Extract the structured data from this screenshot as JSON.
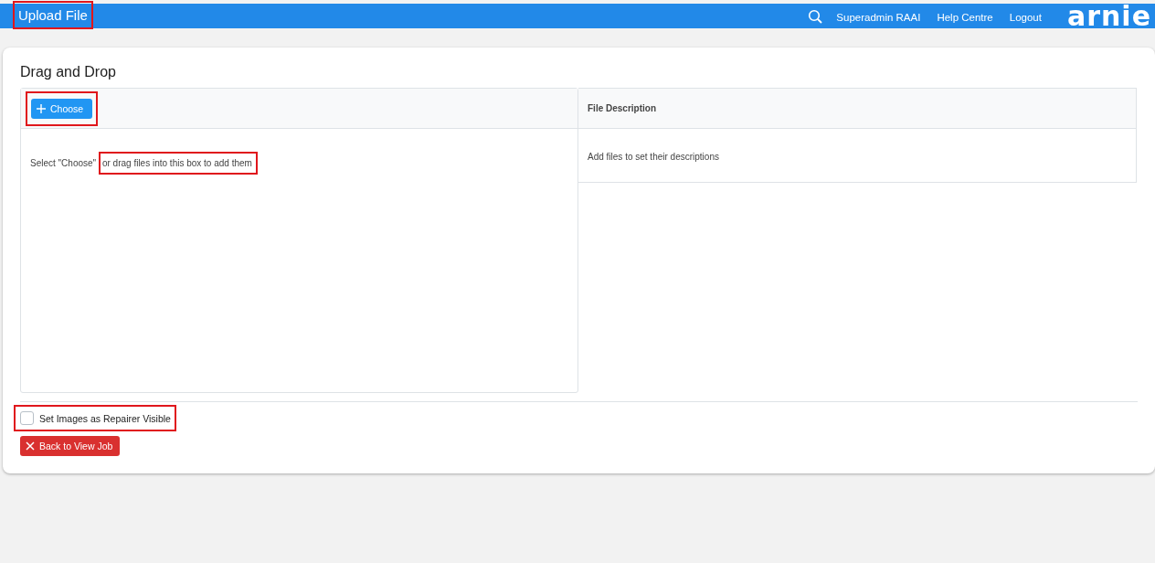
{
  "top_bar": {
    "title": "Upload File",
    "title_highlighted": true,
    "links": [
      "Superadmin RAAI",
      "Help Centre",
      "Logout"
    ],
    "logo": "arnie"
  },
  "card": {
    "title": "Drag and Drop",
    "upload": {
      "choose_button": "Choose",
      "choose_highlighted": true,
      "hint": "Select \"Choose\"",
      "hint_highlighted": "or drag files into this box to add them"
    },
    "description": {
      "header": "File Description",
      "empty_text": "Add files to set their descriptions"
    },
    "checkbox": {
      "label": "Set Images as Repairer Visible",
      "checked": false,
      "highlighted": true
    },
    "back_button": "Back to View Job"
  }
}
